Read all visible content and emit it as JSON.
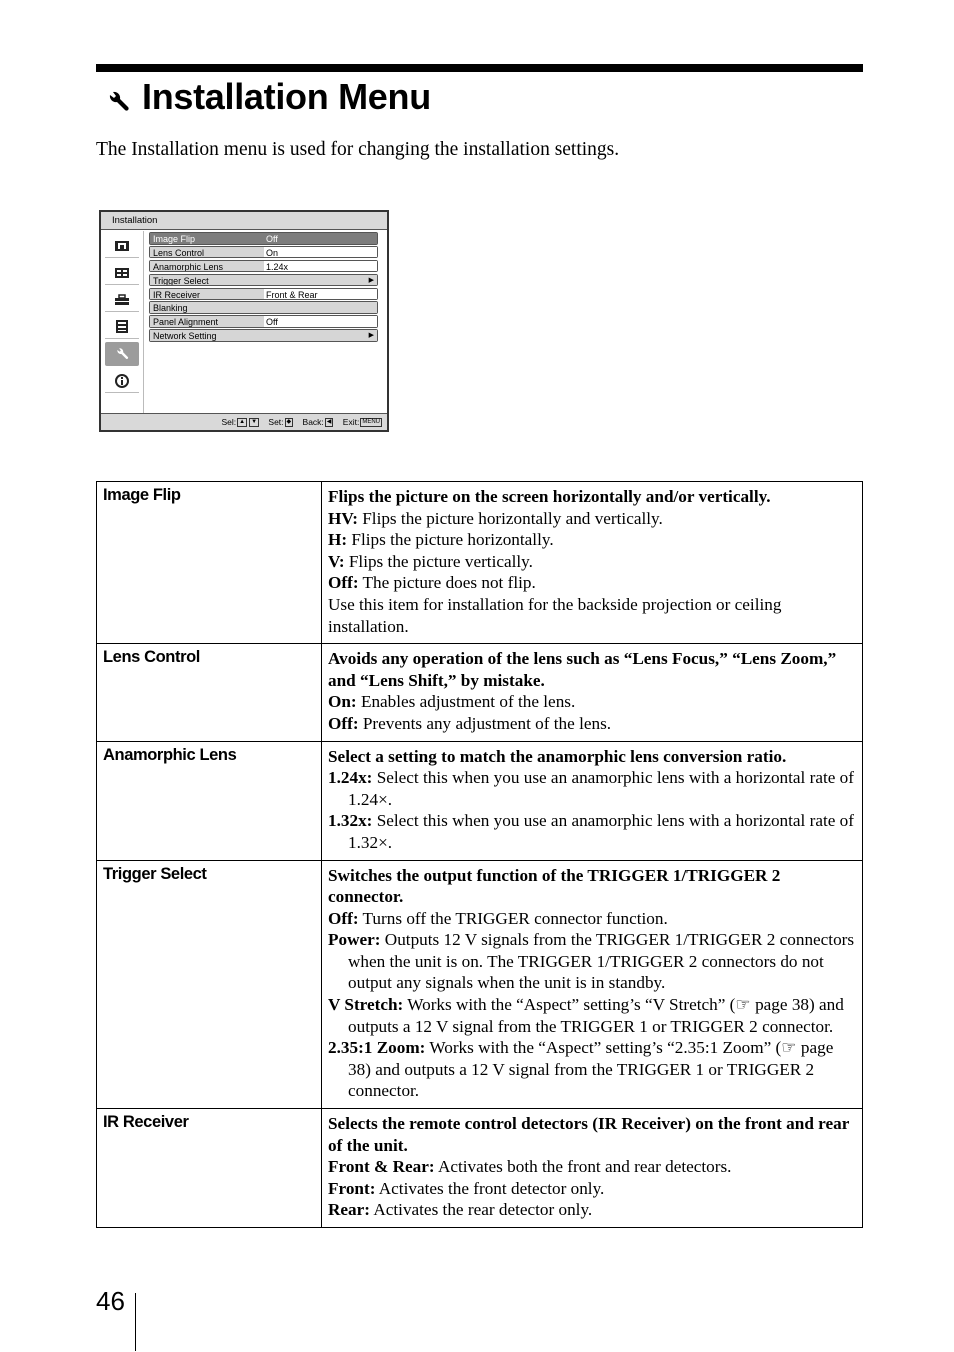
{
  "page": {
    "title": "Installation Menu",
    "title_icon": "wrench-icon",
    "intro": "The Installation menu is used for changing the installation settings.",
    "page_number": "46"
  },
  "osd": {
    "header": "Installation",
    "side_icons": [
      "picture-icon",
      "screen-icon",
      "toolbox-icon",
      "function-icon",
      "wrench-icon",
      "info-icon"
    ],
    "selected_side_icon": "wrench-icon",
    "items": [
      {
        "label": "Image Flip",
        "value": "Off",
        "selected": true,
        "submenu": false
      },
      {
        "label": "Lens Control",
        "value": "On",
        "selected": false,
        "submenu": false
      },
      {
        "label": "Anamorphic Lens",
        "value": "1.24x",
        "selected": false,
        "submenu": false
      },
      {
        "label": "Trigger Select",
        "value": "",
        "selected": false,
        "submenu": true
      },
      {
        "label": "IR Receiver",
        "value": "Front & Rear",
        "selected": false,
        "submenu": false
      },
      {
        "label": "Blanking",
        "value": "",
        "selected": false,
        "submenu": false
      },
      {
        "label": "Panel Alignment",
        "value": "Off",
        "selected": false,
        "submenu": false
      },
      {
        "label": "Network Setting",
        "value": "",
        "selected": false,
        "submenu": true
      }
    ],
    "footer": {
      "sel": "Sel:",
      "set": "Set:",
      "back": "Back:",
      "exit": "Exit:",
      "menu_key": "MENU"
    }
  },
  "table": [
    {
      "name": "Image Flip",
      "lead": "Flips the picture on the screen horizontally and/or vertically.",
      "options": [
        {
          "key": "HV:",
          "text": " Flips the picture horizontally and vertically."
        },
        {
          "key": "H:",
          "text": " Flips the picture horizontally."
        },
        {
          "key": "V:",
          "text": " Flips the picture vertically."
        },
        {
          "key": "Off:",
          "text": " The picture does not flip."
        }
      ],
      "note": "Use this item for installation for the backside projection or ceiling installation."
    },
    {
      "name": "Lens Control",
      "lead": "Avoids any operation of the lens such as “Lens Focus,” “Lens Zoom,” and “Lens Shift,” by mistake.",
      "options": [
        {
          "key": "On:",
          "text": " Enables adjustment of the lens."
        },
        {
          "key": "Off:",
          "text": " Prevents any adjustment of the lens."
        }
      ]
    },
    {
      "name": "Anamorphic Lens",
      "lead": "Select a setting to match the anamorphic lens conversion ratio.",
      "options": [
        {
          "key": "1.24x:",
          "text": " Select this when you use an anamorphic lens with a horizontal rate of 1.24×."
        },
        {
          "key": "1.32x:",
          "text": " Select this when you use an anamorphic lens with a horizontal rate of 1.32×."
        }
      ]
    },
    {
      "name": "Trigger Select",
      "lead": "Switches the output function of the TRIGGER 1/TRIGGER 2 connector.",
      "options": [
        {
          "key": "Off:",
          "text": " Turns off the TRIGGER connector function."
        },
        {
          "key": "Power:",
          "text": " Outputs 12 V signals from the TRIGGER 1/TRIGGER 2 connectors when the unit is on. The TRIGGER 1/TRIGGER 2 connectors do not output any signals when the unit is in standby."
        },
        {
          "key": "V Stretch:",
          "text": " Works with the “Aspect” setting’s “V Stretch” (☞ page 38) and outputs a 12 V signal from the TRIGGER 1 or TRIGGER 2 connector."
        },
        {
          "key": "2.35:1 Zoom:",
          "text": " Works with the “Aspect” setting’s “2.35:1 Zoom” (☞ page 38) and outputs a 12 V signal from the TRIGGER 1 or TRIGGER 2 connector."
        }
      ]
    },
    {
      "name": "IR Receiver",
      "lead": "Selects the remote control detectors (IR Receiver) on the front and rear of the unit.",
      "options": [
        {
          "key": "Front & Rear:",
          "text": " Activates both the front and rear detectors."
        },
        {
          "key": "Front:",
          "text": " Activates the front detector only."
        },
        {
          "key": "Rear:",
          "text": " Activates the rear detector only."
        }
      ]
    }
  ]
}
